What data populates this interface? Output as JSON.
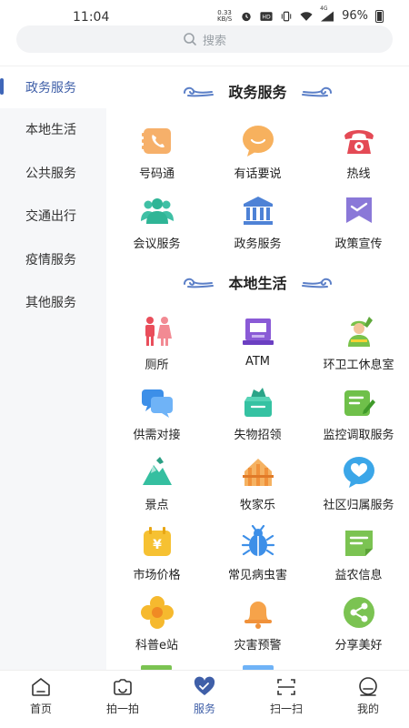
{
  "status_bar": {
    "time": "11:04",
    "net_speed_value": "0.33",
    "net_speed_unit": "KB/S",
    "signal_label": "4G",
    "battery": "96%"
  },
  "search": {
    "placeholder": "搜索"
  },
  "sidebar": {
    "items": [
      {
        "label": "政务服务",
        "active": true
      },
      {
        "label": "本地生活"
      },
      {
        "label": "公共服务"
      },
      {
        "label": "交通出行"
      },
      {
        "label": "疫情服务"
      },
      {
        "label": "其他服务"
      }
    ]
  },
  "sections": [
    {
      "title": "政务服务",
      "items": [
        {
          "label": "号码通",
          "icon": "phone-card-icon"
        },
        {
          "label": "有话要说",
          "icon": "chat-bubble-icon"
        },
        {
          "label": "热线",
          "icon": "telephone-icon"
        },
        {
          "label": "会议服务",
          "icon": "people-icon"
        },
        {
          "label": "政务服务",
          "icon": "government-building-icon"
        },
        {
          "label": "政策宣传",
          "icon": "bookmark-flag-icon"
        }
      ]
    },
    {
      "title": "本地生活",
      "items": [
        {
          "label": "厕所",
          "icon": "restroom-icon"
        },
        {
          "label": "ATM",
          "icon": "atm-icon"
        },
        {
          "label": "环卫工休息室",
          "icon": "sanitation-worker-icon"
        },
        {
          "label": "供需对接",
          "icon": "message-bubbles-icon"
        },
        {
          "label": "失物招领",
          "icon": "lost-found-box-icon"
        },
        {
          "label": "监控调取服务",
          "icon": "edit-document-icon"
        },
        {
          "label": "景点",
          "icon": "scenic-spot-icon"
        },
        {
          "label": "牧家乐",
          "icon": "farm-icon"
        },
        {
          "label": "社区归属服务",
          "icon": "heart-chat-icon"
        },
        {
          "label": "市场价格",
          "icon": "yuan-price-icon"
        },
        {
          "label": "常见病虫害",
          "icon": "bug-icon"
        },
        {
          "label": "益农信息",
          "icon": "note-icon"
        },
        {
          "label": "科普e站",
          "icon": "flower-icon"
        },
        {
          "label": "灾害预警",
          "icon": "bell-icon"
        },
        {
          "label": "分享美好",
          "icon": "share-icon"
        }
      ]
    }
  ],
  "tabbar": {
    "items": [
      {
        "label": "首页",
        "icon": "home-icon"
      },
      {
        "label": "拍一拍",
        "icon": "camera-icon"
      },
      {
        "label": "服务",
        "icon": "heart-service-icon",
        "active": true
      },
      {
        "label": "扫一扫",
        "icon": "scan-icon"
      },
      {
        "label": "我的",
        "icon": "profile-icon"
      }
    ]
  },
  "colors": {
    "accent": "#3f5fa8",
    "sidebar_bg": "#f6f7f9",
    "cloud": "#5b7fc7"
  }
}
